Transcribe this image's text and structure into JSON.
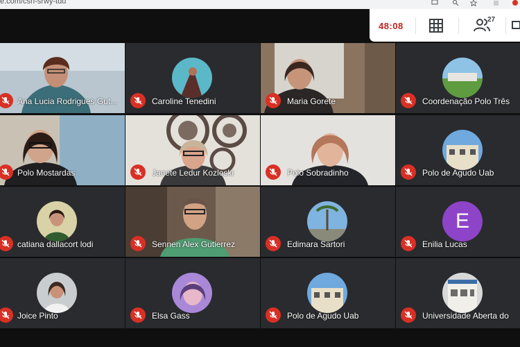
{
  "browser": {
    "url": "e.com/csn-srwy-tdu"
  },
  "meeting": {
    "timer": "48:08",
    "participant_count": "27",
    "colors": {
      "accent": "#d93025",
      "timer": "#c5221f",
      "tile_bg": "#2a2b2e",
      "letter_avatar": "#8e44c9"
    }
  },
  "participants": [
    {
      "name": "Ana Lucia Rodrigues Gut...",
      "type": "video",
      "muted": true
    },
    {
      "name": "Caroline Tenedini",
      "type": "avatar",
      "muted": true
    },
    {
      "name": "Maria Gorete",
      "type": "video",
      "muted": true
    },
    {
      "name": "Coordenação Polo Três",
      "type": "avatar",
      "muted": true
    },
    {
      "name": "Polo Mostardas",
      "type": "video",
      "muted": true
    },
    {
      "name": "Janete Ledur Kozloski",
      "type": "video",
      "muted": true
    },
    {
      "name": "Polo Sobradinho",
      "type": "video",
      "muted": true
    },
    {
      "name": "Polo de Agudo Uab",
      "type": "avatar",
      "muted": true
    },
    {
      "name": "catiana dallacort lodi",
      "type": "avatar",
      "muted": true
    },
    {
      "name": "Sennen Alex Gutierrez",
      "type": "video",
      "muted": true
    },
    {
      "name": "Edimara Sartori",
      "type": "avatar",
      "muted": true
    },
    {
      "name": "Enilia Lucas",
      "type": "letter",
      "letter": "E",
      "muted": true
    },
    {
      "name": "Joice Pinto",
      "type": "avatar",
      "muted": true
    },
    {
      "name": "Elsa Gass",
      "type": "avatar",
      "muted": true
    },
    {
      "name": "Polo de Agudo Uab",
      "type": "avatar",
      "muted": true
    },
    {
      "name": "Universidade Aberta do",
      "type": "avatar",
      "muted": true
    }
  ]
}
